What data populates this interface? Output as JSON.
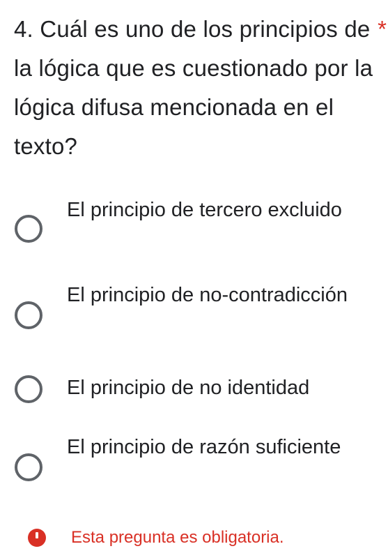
{
  "question": {
    "title": "4. Cuál es uno de los principios de la lógica que es cuestionado por la lógica difusa mencionada en el texto?",
    "required_marker": "*"
  },
  "options": [
    {
      "label": "El principio de tercero excluido",
      "selected": false
    },
    {
      "label": "El principio de no-contradicción",
      "selected": false
    },
    {
      "label": "El principio de no identidad",
      "selected": false
    },
    {
      "label": "El principio de razón suficiente",
      "selected": false
    }
  ],
  "validation": {
    "message": "Esta pregunta es obligatoria.",
    "icon": "alert-circle-icon",
    "color": "#d93025"
  }
}
